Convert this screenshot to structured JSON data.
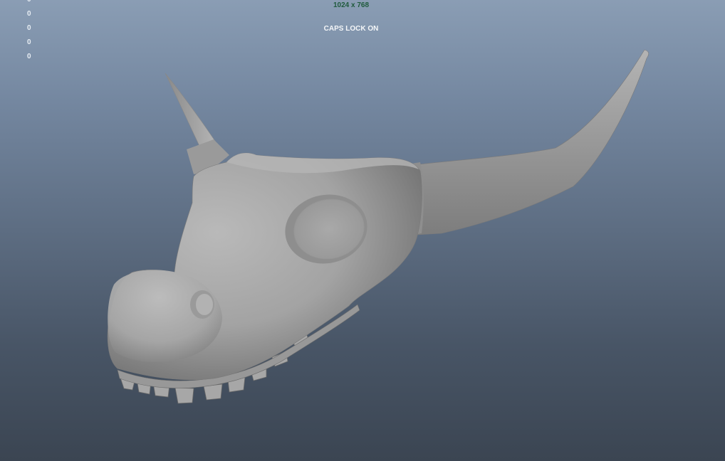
{
  "viewport": {
    "resolution_gate": "1024 x 768",
    "caps_lock_message": "CAPS LOCK ON",
    "hud_values": [
      "0",
      "0",
      "0",
      "0",
      "0"
    ]
  },
  "scene": {
    "model": "skull-with-horns",
    "material": "default-gray-lambert",
    "background_top": "#8a9db4",
    "background_bottom": "#3b4552"
  }
}
